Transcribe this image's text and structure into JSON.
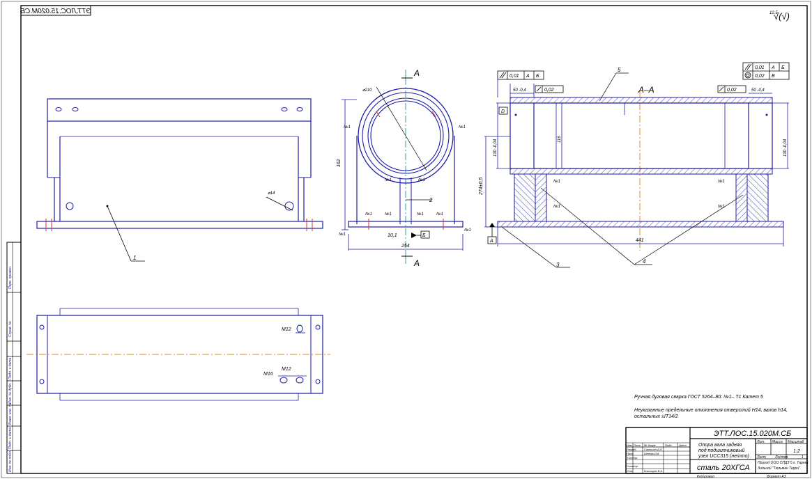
{
  "stamp_code": "ЭТТ.ЛОС.15.020М.СБ",
  "roughness": "√(√)",
  "roughness_value": "12,5",
  "views": {
    "section_title": "А–А",
    "section_marker_top": "А",
    "section_marker_bottom": "А",
    "datum_a": "А",
    "datum_b": "Б",
    "datum_d": "D",
    "diameter_210": "⌀210",
    "diameter_14": "⌀14",
    "dim_162": "162",
    "dim_254": "254",
    "dim_101": "10,1",
    "dim_274": "274±0,5",
    "dim_130_left": "130 -0,04",
    "dim_130_right": "130 -0,04",
    "dim_116": "116",
    "dim_441": "441",
    "dim_50_left": "50 -0,4",
    "dim_50_right": "50 -0,4",
    "tol_left_flat": "0,02",
    "tol_right_flat": "0,02",
    "tol_parallel": "0,01",
    "tol_parallel_ref_a": "А",
    "tol_parallel_ref_b": "Б",
    "tol_right_1": "0,01",
    "tol_right_1_ref": "А",
    "tol_right_1_ref2": "Б",
    "tol_right_2": "0,02",
    "tol_right_2_ref": "В",
    "thread_m12_top": "М12",
    "thread_m12_bottom": "М12",
    "thread_m16": "М16",
    "weld_n1": "№1",
    "leader_1": "1",
    "leader_2": "2",
    "leader_3": "3",
    "leader_4": "4",
    "leader_5": "5"
  },
  "notes": {
    "line1": "Ручная дуговая сварка ГОСТ 5264–80: №1– Т1 Катет 5",
    "line2": "Неуказанные предельные отклонения отверстий  Н14, валов h14,",
    "line3": "остальных  ±IT14/2"
  },
  "title_block": {
    "code": "ЭТТ.ЛОС.15.020М.СБ",
    "name_line1": "Опора вала задняя",
    "name_line2": "под подшипниковый",
    "name_line3": "узел UCC315 (нетто)",
    "material": "сталь 20ХГСА",
    "col_lit": "Лит.",
    "col_mass": "Масса",
    "col_scale": "Масштаб",
    "scale": "1:2",
    "sheet": "Лист",
    "sheets": "Листов",
    "sheets_count": "1",
    "company_line1": "Приход ООО СПДЗ 5 г. Тарнак",
    "company_line2": "Зильной \"Тюльман Терри\"",
    "row_izm": "Изм.",
    "row_list": "Лист",
    "row_doc": "№ докум.",
    "row_sign": "Подп.",
    "row_date": "Дата",
    "row_razrab": "Разраб.",
    "row_prov": "Пров.",
    "row_tkontr": "Т.контр.",
    "row_nkontr": "Н.контр.",
    "row_utv": "Утв.",
    "name_razrab": "Самошин Д.Л.",
    "name_prov": "Шевчук Д.А.",
    "name_utv": "Козлищев В.А.",
    "copied": "Копировал",
    "format": "Формат   А3"
  },
  "side_stamp": {
    "perv_primen": "Перв. примен.",
    "sprav": "Справ. №",
    "podp_date1": "Подп. и дата",
    "inv_dubl": "Инв. № дубл.",
    "vzam_inv": "Взам. инв. №",
    "podp_date2": "Подп. и дата",
    "inv_podl": "Инв. № подл."
  }
}
